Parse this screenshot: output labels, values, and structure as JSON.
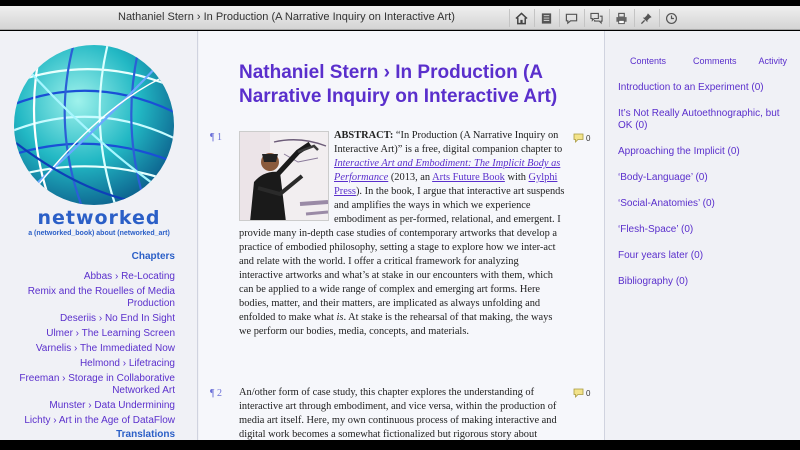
{
  "app": {
    "title": "Nathaniel Stern › In Production (A Narrative Inquiry on Interactive Art)",
    "toolbar_icons": [
      "home-icon",
      "document-icon",
      "comment-icon",
      "comments-icon",
      "print-icon",
      "pin-icon",
      "clock-icon"
    ]
  },
  "sidebar": {
    "logo_word": "networked",
    "logo_tagline": "a (networked_book) about (networked_art)",
    "chapters_heading": "Chapters",
    "chapters": [
      "Abbas › Re-Locating",
      "Remix and the Rouelles of Media Production",
      "Deseriis › No End In Sight",
      "Ulmer › The Learning Screen",
      "Varnelis › The Immediated Now",
      "Helmond › Lifetracing",
      "Freeman › Storage in Collaborative Networked Art",
      "Munster › Data Undermining",
      "Lichty › Art in the Age of DataFlow"
    ],
    "translations_heading": "Translations"
  },
  "main": {
    "title": "Nathaniel Stern › In Production (A Narrative Inquiry on Interactive Art)",
    "paragraphs": [
      {
        "num": "¶ 1",
        "comment_count": "0",
        "lead": "ABSTRACT:",
        "t1": " “In Production (A Narrative Inquiry on Interactive Art)” is a free, digital companion chapter to ",
        "link1": "Interactive Art and Embodiment: The Implicit Body as Performance",
        "t2": " (2013, an ",
        "link2": "Arts Future Book",
        "t3": " with ",
        "link3": "Gylphi Press",
        "t4": "). In the book, I argue that interactive art suspends and amplifies the ways in which we experience embodiment as per-formed, relational, and emergent. I provide many in-depth case studies of contemporary artworks that develop a practice of embodied philosophy, setting a stage to explore how we inter-act and relate with the world. I offer a critical framework for analyzing interactive artworks and what’s at stake in our encounters with them, which can be applied to a wide range of complex and emerging art forms. Here bodies, matter, and their matters, are implicated as always unfolding and enfolded to make what ",
        "em1": "is",
        "t5": ". At stake is the rehearsal of that making, the ways we perform our bodies, media, concepts, and materials."
      },
      {
        "num": "¶ 2",
        "comment_count": "0",
        "text": "An/other form of case study, this chapter explores the understanding of interactive art through embodiment, and vice versa, within the production of media art itself. Here, my own continuous process of making interactive and digital work becomes a somewhat fictionalized but rigorous story about"
      }
    ]
  },
  "right": {
    "tabs": [
      "Contents",
      "Comments",
      "Activity"
    ],
    "toc": [
      "Introduction to an Experiment (0)",
      "It’s Not Really Autoethnographic, but OK (0)",
      "Approaching the Implicit (0)",
      "‘Body-Language’ (0)",
      "‘Social-Anatomies’ (0)",
      "‘Flesh-Space’ (0)",
      "Four years later (0)",
      "Bibliography (0)"
    ]
  },
  "colors": {
    "link": "#5a2fcc",
    "brand": "#2b5fc7",
    "background": "#f0f1f6"
  }
}
